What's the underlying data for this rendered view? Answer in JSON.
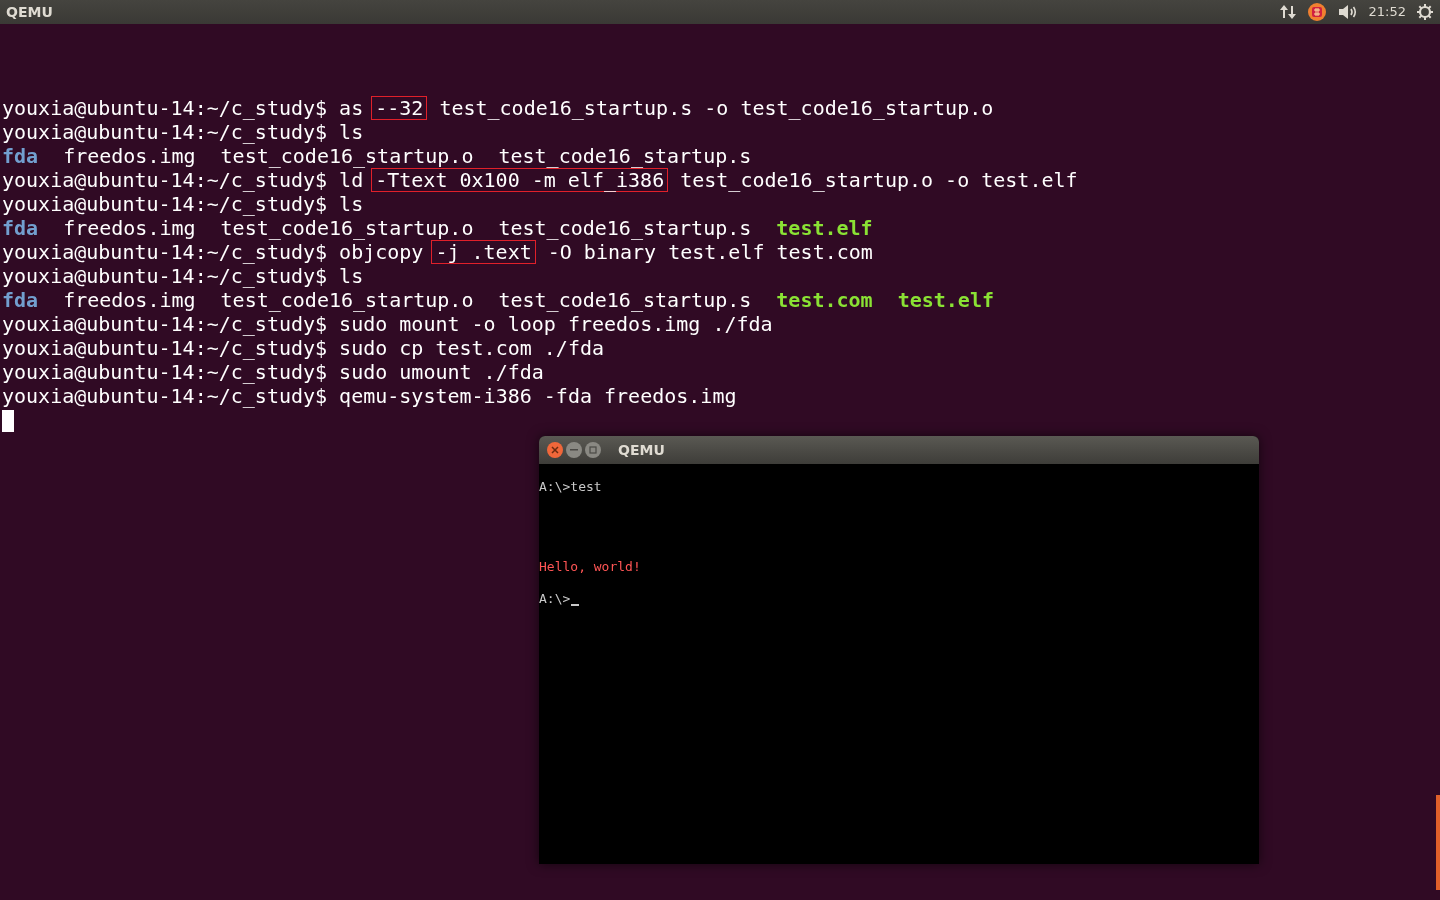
{
  "top_bar": {
    "title": "QEMU",
    "clock": "21:52"
  },
  "terminal": {
    "lines": [
      {
        "kind": "command",
        "prompt": "youxia@ubuntu-14:~/c_study$",
        "parts": [
          {
            "text": "as",
            "boxed": false
          },
          {
            "text": "--32",
            "boxed": true
          },
          {
            "text": "test_code16_startup.s -o test_code16_startup.o",
            "boxed": false
          }
        ]
      },
      {
        "kind": "command",
        "prompt": "youxia@ubuntu-14:~/c_study$",
        "parts": [
          {
            "text": "ls",
            "boxed": false
          }
        ]
      },
      {
        "kind": "listing",
        "files": [
          {
            "name": "fda",
            "kind": "dir"
          },
          {
            "name": "freedos.img",
            "kind": "file"
          },
          {
            "name": "test_code16_startup.o",
            "kind": "file"
          },
          {
            "name": "test_code16_startup.s",
            "kind": "file"
          }
        ]
      },
      {
        "kind": "command",
        "prompt": "youxia@ubuntu-14:~/c_study$",
        "parts": [
          {
            "text": "ld",
            "boxed": false
          },
          {
            "text": "-Ttext 0x100 -m elf_i386",
            "boxed": true
          },
          {
            "text": "test_code16_startup.o -o test.elf",
            "boxed": false
          }
        ]
      },
      {
        "kind": "command",
        "prompt": "youxia@ubuntu-14:~/c_study$",
        "parts": [
          {
            "text": "ls",
            "boxed": false
          }
        ]
      },
      {
        "kind": "listing",
        "files": [
          {
            "name": "fda",
            "kind": "dir"
          },
          {
            "name": "freedos.img",
            "kind": "file"
          },
          {
            "name": "test_code16_startup.o",
            "kind": "file"
          },
          {
            "name": "test_code16_startup.s",
            "kind": "file"
          },
          {
            "name": "test.elf",
            "kind": "exe"
          }
        ]
      },
      {
        "kind": "command",
        "prompt": "youxia@ubuntu-14:~/c_study$",
        "parts": [
          {
            "text": "objcopy",
            "boxed": false
          },
          {
            "text": "-j .text",
            "boxed": true
          },
          {
            "text": "-O binary test.elf test.com",
            "boxed": false
          }
        ]
      },
      {
        "kind": "command",
        "prompt": "youxia@ubuntu-14:~/c_study$",
        "parts": [
          {
            "text": "ls",
            "boxed": false
          }
        ]
      },
      {
        "kind": "listing",
        "files": [
          {
            "name": "fda",
            "kind": "dir"
          },
          {
            "name": "freedos.img",
            "kind": "file"
          },
          {
            "name": "test_code16_startup.o",
            "kind": "file"
          },
          {
            "name": "test_code16_startup.s",
            "kind": "file"
          },
          {
            "name": "test.com",
            "kind": "exe"
          },
          {
            "name": "test.elf",
            "kind": "exe"
          }
        ]
      },
      {
        "kind": "command",
        "prompt": "youxia@ubuntu-14:~/c_study$",
        "parts": [
          {
            "text": "sudo mount -o loop freedos.img ./fda",
            "boxed": false
          }
        ]
      },
      {
        "kind": "command",
        "prompt": "youxia@ubuntu-14:~/c_study$",
        "parts": [
          {
            "text": "sudo cp test.com ./fda",
            "boxed": false
          }
        ]
      },
      {
        "kind": "command",
        "prompt": "youxia@ubuntu-14:~/c_study$",
        "parts": [
          {
            "text": "sudo umount ./fda",
            "boxed": false
          }
        ]
      },
      {
        "kind": "command",
        "prompt": "youxia@ubuntu-14:~/c_study$",
        "parts": [
          {
            "text": "qemu-system-i386 -fda freedos.img",
            "boxed": false
          }
        ]
      }
    ],
    "cursor": true
  },
  "qemu_window": {
    "title": "QEMU",
    "lines": [
      {
        "text": "A:\\>test",
        "kind": "plain",
        "cursor": false
      },
      {
        "text": "Hello, world!",
        "kind": "red",
        "cursor": false
      },
      {
        "text": "A:\\>",
        "kind": "plain",
        "cursor": true
      }
    ]
  }
}
